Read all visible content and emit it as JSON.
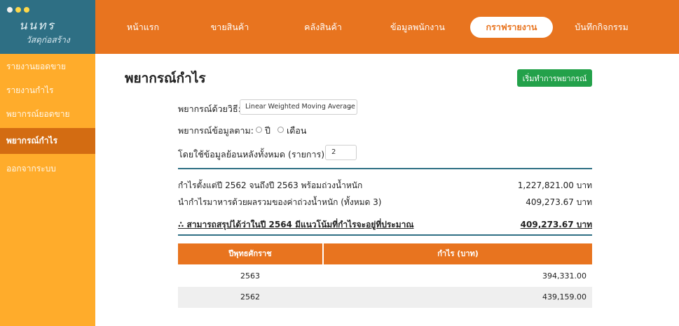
{
  "brand": {
    "title": " นนทร",
    "subtitle": "วัสดุก่อสร้าง",
    "dot_colors": [
      "#f0f0f0",
      "#ffd84a",
      "#ffd84a"
    ]
  },
  "topnav": {
    "items": [
      {
        "label": "หน้าแรก"
      },
      {
        "label": "ขายสินค้า"
      },
      {
        "label": "คลังสินค้า"
      },
      {
        "label": "ข้อมูลพนักงาน"
      },
      {
        "label": "กราฟรายงาน"
      },
      {
        "label": "บันทึกกิจกรรม"
      }
    ],
    "active": "กราฟรายงาน"
  },
  "sidebar": {
    "items": [
      {
        "label": "รายงานยอดขาย"
      },
      {
        "label": "รายงานกำไร"
      },
      {
        "label": "พยากรณ์ยอดขาย"
      },
      {
        "label": "พยากรณ์กำไร"
      },
      {
        "label": "ออกจากระบบ"
      }
    ],
    "active": "พยากรณ์กำไร"
  },
  "page": {
    "title": "พยากรณ์กำไร",
    "start_button": "เริ่มทำการพยากรณ์"
  },
  "form": {
    "method_label": "พยากรณ์ด้วยวิธี:",
    "method_value": "Linear Weighted Moving Average",
    "basis_label": "พยากรณ์ข้อมูลตาม:",
    "basis_options": [
      "ปี",
      "เดือน"
    ],
    "lookback_label": "โดยใช้ข้อมูลย้อนหลังทั้งหมด (รายการ):",
    "lookback_value": "2"
  },
  "results": {
    "line1_label": "กำไรตั้งแต่ปี 2562 จนถึงปี 2563 พร้อมถ่วงน้ำหนัก",
    "line1_value": "1,227,821.00 บาท",
    "line2_label": "นำกำไรมาหารด้วยผลรวมของค่าถ่วงน้ำหนัก (ทั้งหมด 3)",
    "line2_value": "409,273.67 บาท",
    "conclusion_label": "∴ สามารถสรุปได้ว่าในปี 2564 มีแนวโน้มที่กำไรจะอยู่ที่ประมาณ",
    "conclusion_value": "409,273.67 บาท"
  },
  "table": {
    "headers": [
      "ปีพุทธศักราช",
      "กำไร (บาท)"
    ],
    "rows": [
      {
        "year": "2563",
        "profit": "394,331.00"
      },
      {
        "year": "2562",
        "profit": "439,159.00"
      }
    ]
  },
  "colors": {
    "nav_orange": "#e8741f",
    "sidebar_orange": "#ffac2b",
    "sidebar_active": "#d36c12",
    "teal": "#2e6f84",
    "green": "#23a14a"
  }
}
